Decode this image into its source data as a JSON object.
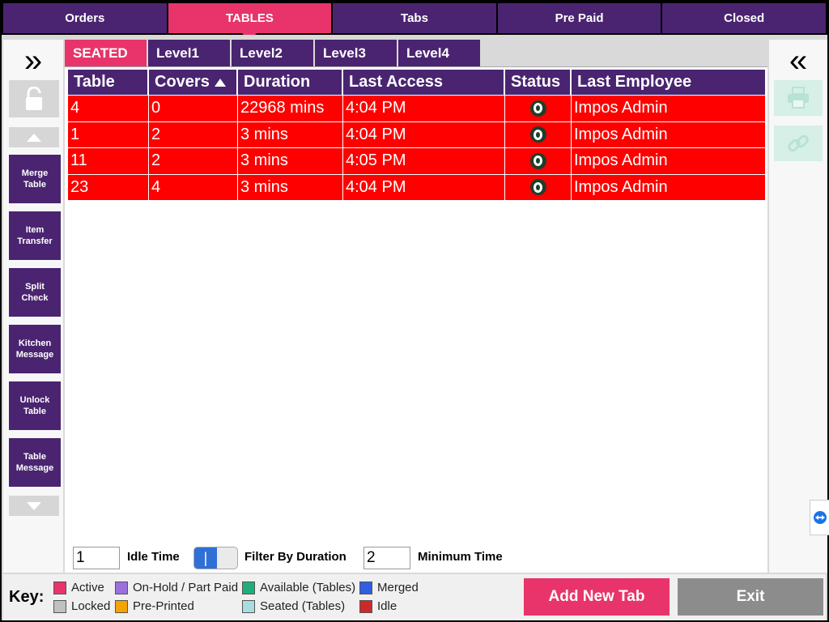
{
  "top_tabs": [
    {
      "label": "Orders",
      "active": false
    },
    {
      "label": "TABLES",
      "active": true
    },
    {
      "label": "Tabs",
      "active": false
    },
    {
      "label": "Pre Paid",
      "active": false
    },
    {
      "label": "Closed",
      "active": false
    }
  ],
  "level_tabs": [
    {
      "label": "SEATED",
      "active": true
    },
    {
      "label": "Level1",
      "active": false
    },
    {
      "label": "Level2",
      "active": false
    },
    {
      "label": "Level3",
      "active": false
    },
    {
      "label": "Level4",
      "active": false
    }
  ],
  "left_panel": {
    "expand_glyph": "»",
    "buttons": [
      {
        "label": "Merge Table"
      },
      {
        "label": "Item Transfer"
      },
      {
        "label": "Split Check"
      },
      {
        "label": "Kitchen Message"
      },
      {
        "label": "Unlock Table"
      },
      {
        "label": "Table Message"
      }
    ]
  },
  "right_panel": {
    "collapse_glyph": "«"
  },
  "table": {
    "columns": [
      "Table",
      "Covers",
      "Duration",
      "Last Access",
      "Status",
      "Last Employee"
    ],
    "sort_column": "Covers",
    "sort_direction": "ascending",
    "rows": [
      {
        "table": "4",
        "covers": "0",
        "duration": "22968 mins",
        "last_access": "4:04 PM",
        "status": "seated",
        "last_employee": "Impos Admin"
      },
      {
        "table": "1",
        "covers": "2",
        "duration": "3 mins",
        "last_access": "4:04 PM",
        "status": "seated",
        "last_employee": "Impos Admin"
      },
      {
        "table": "11",
        "covers": "2",
        "duration": "3 mins",
        "last_access": "4:05 PM",
        "status": "seated",
        "last_employee": "Impos Admin"
      },
      {
        "table": "23",
        "covers": "4",
        "duration": "3 mins",
        "last_access": "4:04 PM",
        "status": "seated",
        "last_employee": "Impos Admin"
      }
    ]
  },
  "filter": {
    "idle_time_value": "1",
    "idle_time_label": "Idle Time",
    "toggle_on": true,
    "filter_label": "Filter By Duration",
    "minimum_time_value": "2",
    "minimum_time_label": "Minimum Time"
  },
  "footer": {
    "key_label": "Key:",
    "legend": [
      {
        "label": "Active",
        "color": "#e8346a"
      },
      {
        "label": "Locked",
        "color": "#c0c0c0"
      },
      {
        "label": "On-Hold / Part Paid",
        "color": "#9b6fdc"
      },
      {
        "label": "Pre-Printed",
        "color": "#f5a300"
      },
      {
        "label": "Available (Tables)",
        "color": "#1fae7a"
      },
      {
        "label": "Seated (Tables)",
        "color": "#a8dde0"
      },
      {
        "label": "Merged",
        "color": "#2f5fe0"
      },
      {
        "label": "Idle",
        "color": "#cc2a2a"
      }
    ],
    "add_new_tab_label": "Add New Tab",
    "exit_label": "Exit"
  },
  "colors": {
    "brand_purple": "#4a2470",
    "accent_pink": "#e8346a",
    "row_red": "#fe0000"
  }
}
